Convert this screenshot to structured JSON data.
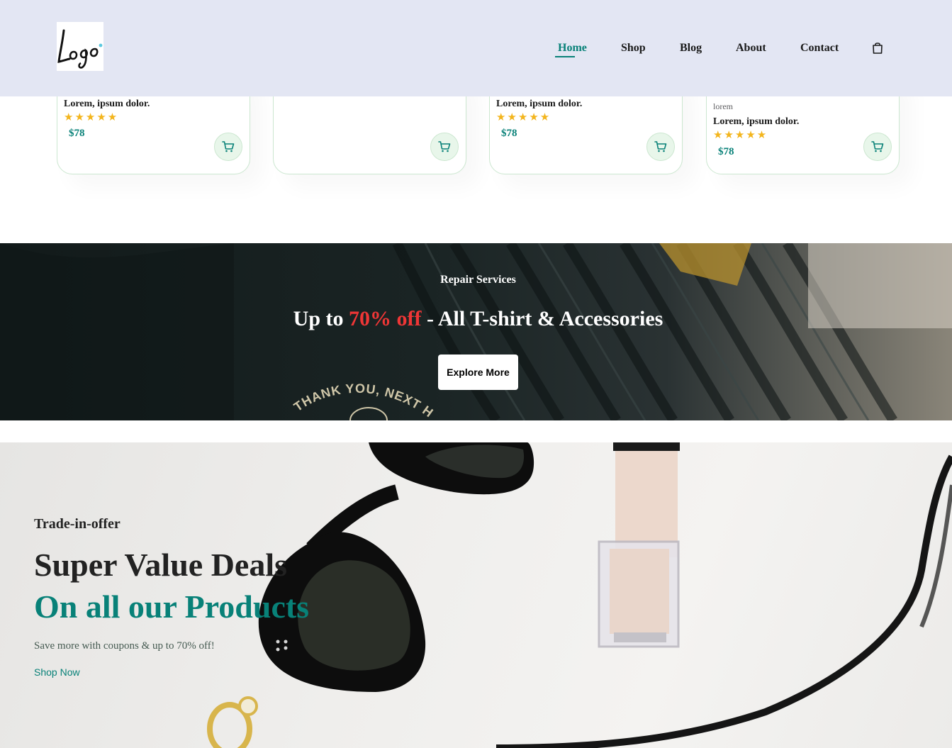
{
  "header": {
    "logo_text": "Logo",
    "nav": [
      {
        "label": "Home",
        "active": true
      },
      {
        "label": "Shop",
        "active": false
      },
      {
        "label": "Blog",
        "active": false
      },
      {
        "label": "About",
        "active": false
      },
      {
        "label": "Contact",
        "active": false
      }
    ],
    "cart_icon": "shopping-bag-icon"
  },
  "products": [
    {
      "brand": "",
      "name": "Lorem, ipsum dolor.",
      "rating": 5,
      "stars": "★★★★★",
      "price": "$78"
    },
    {
      "brand": "",
      "name": "",
      "rating": 0,
      "stars": "",
      "price": ""
    },
    {
      "brand": "",
      "name": "Lorem, ipsum dolor.",
      "rating": 5,
      "stars": "★★★★★",
      "price": "$78"
    },
    {
      "brand": "lorem",
      "name": "Lorem, ipsum dolor.",
      "rating": 5,
      "stars": "★★★★★",
      "price": "$78"
    }
  ],
  "banner": {
    "label": "Repair Services",
    "title_prefix": "Up to ",
    "title_highlight": "70% off",
    "title_suffix": " - All T-shirt & Accessories",
    "button_label": "Explore More",
    "shirt_print": "THANK YOU, NEXT HATER"
  },
  "hero": {
    "subtitle": "Trade-in-offer",
    "title_line1": "Super Value Deals",
    "title_line2": "On all our Products",
    "description": "Save more with coupons & up to 70% off!",
    "link_label": "Shop Now"
  },
  "colors": {
    "accent": "#088178",
    "header_bg": "#e3e6f3",
    "star": "#f3b51d",
    "highlight_red": "#ef3636",
    "card_border": "#cce7d0"
  }
}
